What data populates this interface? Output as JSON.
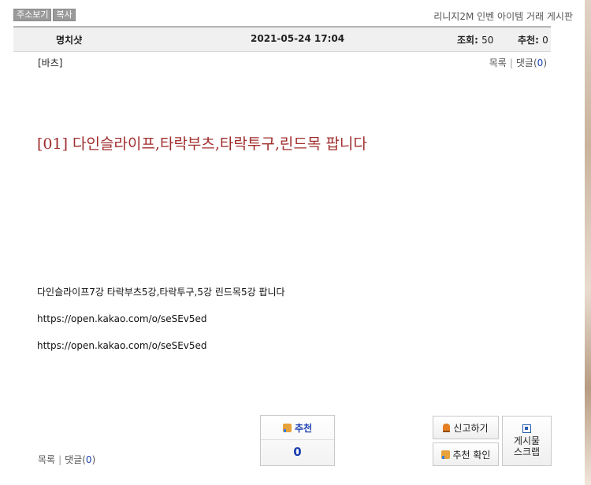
{
  "toolbar": {
    "address_button": "주소보기",
    "copy_button": "복사"
  },
  "board_title": "리니지2M 인벤 아이템 거래 게시판",
  "post_info": {
    "author": "명치샷",
    "date": "2021-05-24 17:04",
    "views_label": "조회:",
    "views_value": "50",
    "recommend_label": "추천:",
    "recommend_value": "0"
  },
  "category": "[바츠]",
  "links": {
    "list": "목록",
    "separator": "|",
    "comments_label": "댓글",
    "comments_open": "(",
    "comments_count": "0",
    "comments_close": ")"
  },
  "post_title": "[01] 다인슬라이프,타락부츠,타락투구,린드목 팝니다",
  "body_lines": [
    "다인슬라이프7강 타락부츠5강,타락투구,5강 린드목5강 팝니다",
    "https://open.kakao.com/o/seSEv5ed",
    "https://open.kakao.com/o/seSEv5ed"
  ],
  "recommend_box": {
    "label": "추천",
    "count": "0"
  },
  "buttons": {
    "report": "신고하기",
    "recommend_check": "추천 확인",
    "scrap_line1": "게시물",
    "scrap_line2": "스크랩"
  },
  "icons": {
    "recommend": "thumbs-up-icon",
    "report": "bell-icon",
    "scrap": "scrap-icon"
  },
  "colors": {
    "title": "#a02d2d",
    "accent": "#1a3fb0"
  }
}
